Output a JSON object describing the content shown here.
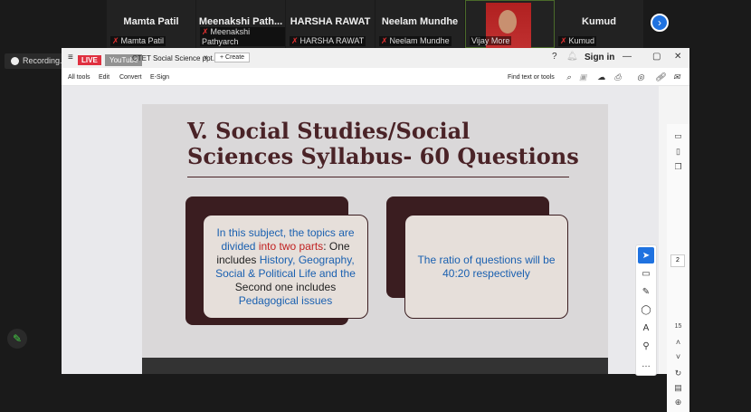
{
  "participants": [
    {
      "name": "Mamta Patil",
      "label": "Mamta Patil",
      "muted": true
    },
    {
      "name": "Meenakshi  Path...",
      "label": "Meenakshi Pathyarch",
      "muted": true
    },
    {
      "name": "HARSHA RAWAT",
      "label": "HARSHA RAWAT",
      "muted": true
    },
    {
      "name": "Neelam Mundhe",
      "label": "Neelam Mundhe",
      "muted": true
    },
    {
      "name": "",
      "label": "Vijay More",
      "muted": false
    },
    {
      "name": "Kumud",
      "label": "Kumud",
      "muted": true
    }
  ],
  "recording": "Recording...",
  "browser": {
    "live": "LIVE",
    "youtube": "YouTube",
    "tab_title": "CTET Social Science ppt...",
    "create": "+ Create",
    "sign_in": "Sign in"
  },
  "toolbar": {
    "all_tools": "All tools",
    "edit": "Edit",
    "convert": "Convert",
    "esign": "E-Sign",
    "find": "Find text or tools"
  },
  "slide": {
    "title_line1": "V. Social Studies/Social",
    "title_line2": "Sciences Syllabus- 60 Questions",
    "box1": {
      "p1": "In this subject, the topics are divided ",
      "p2": "into two parts",
      "p3": ": ",
      "p4": "One includes ",
      "p5": "History, Geography, Social & Political Life and the ",
      "p6": "Second one includes ",
      "p7": "Pedagogical issues"
    },
    "box2": "The ratio of questions will be 40:20 respectively"
  },
  "page": {
    "current": "2",
    "total": "15"
  },
  "colors": {
    "accent": "#1f72e0",
    "live": "#e03040",
    "slide_title": "#4a2327",
    "slide_text": "#1a60b0"
  }
}
